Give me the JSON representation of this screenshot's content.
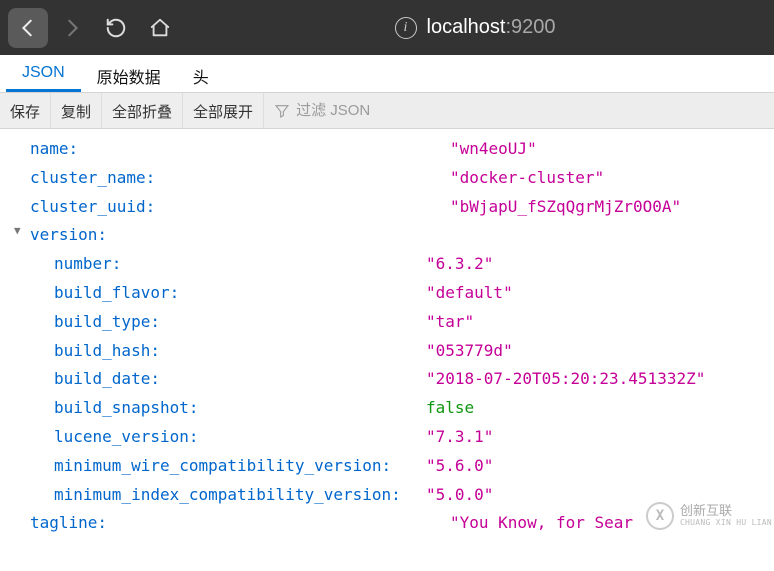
{
  "url": {
    "host": "localhost",
    "port": ":9200"
  },
  "tabs": {
    "json": "JSON",
    "raw": "原始数据",
    "headers": "头"
  },
  "toolbar": {
    "save": "保存",
    "copy": "复制",
    "collapse_all": "全部折叠",
    "expand_all": "全部展开",
    "filter_placeholder": "过滤 JSON"
  },
  "json": {
    "name_key": "name:",
    "name_val": "\"wn4eoUJ\"",
    "cluster_name_key": "cluster_name:",
    "cluster_name_val": "\"docker-cluster\"",
    "cluster_uuid_key": "cluster_uuid:",
    "cluster_uuid_val": "\"bWjapU_fSZqQgrMjZr0O0A\"",
    "version_key": "version:",
    "number_key": "number:",
    "number_val": "\"6.3.2\"",
    "build_flavor_key": "build_flavor:",
    "build_flavor_val": "\"default\"",
    "build_type_key": "build_type:",
    "build_type_val": "\"tar\"",
    "build_hash_key": "build_hash:",
    "build_hash_val": "\"053779d\"",
    "build_date_key": "build_date:",
    "build_date_val": "\"2018-07-20T05:20:23.451332Z\"",
    "build_snapshot_key": "build_snapshot:",
    "build_snapshot_val": "false",
    "lucene_version_key": "lucene_version:",
    "lucene_version_val": "\"7.3.1\"",
    "min_wire_key": "minimum_wire_compatibility_version:",
    "min_wire_val": "\"5.6.0\"",
    "min_index_key": "minimum_index_compatibility_version:",
    "min_index_val": "\"5.0.0\"",
    "tagline_key": "tagline:",
    "tagline_val": "\"You Know, for Sear"
  },
  "watermark": {
    "cn": "创新互联",
    "en": "CHUANG XIN HU LIAN"
  }
}
